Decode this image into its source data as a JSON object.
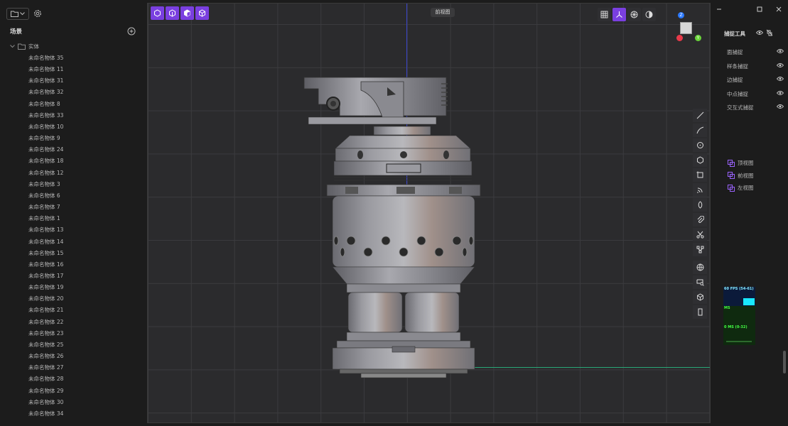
{
  "scene": {
    "title": "场景",
    "root_label": "实体",
    "items": [
      "未命名物体 35",
      "未命名物体 11",
      "未命名物体 31",
      "未命名物体 32",
      "未命名物体 8",
      "未命名物体 33",
      "未命名物体 10",
      "未命名物体 9",
      "未命名物体 24",
      "未命名物体 18",
      "未命名物体 12",
      "未命名物体 3",
      "未命名物体 6",
      "未命名物体 7",
      "未命名物体 1",
      "未命名物体 13",
      "未命名物体 14",
      "未命名物体 15",
      "未命名物体 16",
      "未命名物体 17",
      "未命名物体 19",
      "未命名物体 20",
      "未命名物体 21",
      "未命名物体 22",
      "未命名物体 23",
      "未命名物体 25",
      "未命名物体 26",
      "未命名物体 27",
      "未命名物体 28",
      "未命名物体 29",
      "未命名物体 30",
      "未命名物体 34"
    ]
  },
  "viewport": {
    "view_label": "前视图",
    "top_left_icons": [
      "view-top-icon",
      "view-front-icon",
      "view-left-icon",
      "view-iso-icon"
    ],
    "top_right_icons": [
      "grid-icon",
      "axis-icon",
      "render-icon",
      "shade-icon"
    ],
    "toolbar_icons": [
      "line-icon",
      "curve-icon",
      "circle-icon",
      "polygon-icon",
      "rect-icon",
      "arc-icon",
      "ellipse-icon",
      "attach-icon",
      "cut-icon",
      "node-icon",
      "globe-icon",
      "search-cube-icon",
      "cube-icon",
      "panel-icon"
    ],
    "gizmo": {
      "z": "Z",
      "y": "Y"
    }
  },
  "snap": {
    "title": "捕捉工具",
    "items": [
      "面捕捉",
      "样条捕捉",
      "边捕捉",
      "中点捕捉",
      "交互式捕捉"
    ]
  },
  "views": [
    "顶视图",
    "前视图",
    "左视图"
  ],
  "stats": {
    "fps": "60 FPS (54-61)",
    "ms_label": "MS",
    "ms": "0 MS (0-32)"
  },
  "colors": {
    "accent": "#7a3fe0",
    "axis_blue": "#3a44c8",
    "axis_green": "#2aa878"
  }
}
